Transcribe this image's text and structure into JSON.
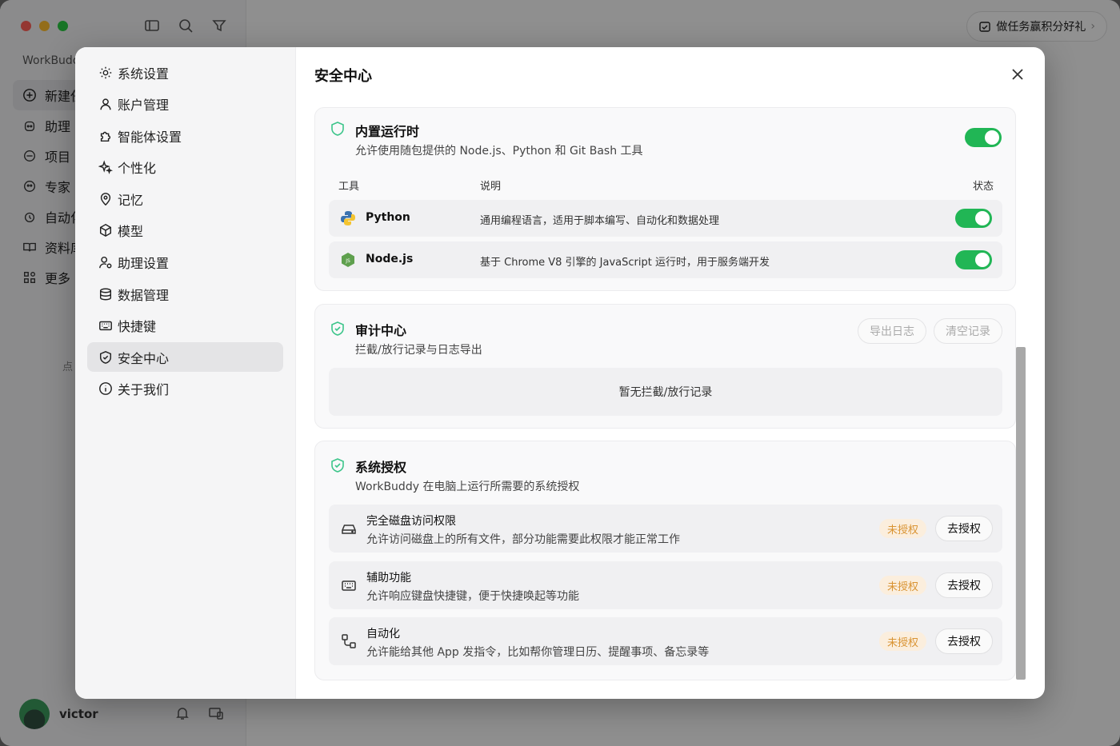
{
  "background": {
    "brand": "WorkBudd",
    "nav": [
      {
        "label": "新建任",
        "icon": "plus-circle-icon"
      },
      {
        "label": "助理",
        "icon": "robot-icon"
      },
      {
        "label": "项目",
        "icon": "project-icon"
      },
      {
        "label": "专家",
        "icon": "expert-icon"
      },
      {
        "label": "自动化",
        "icon": "alarm-icon"
      },
      {
        "label": "资料库",
        "icon": "book-icon"
      },
      {
        "label": "更多",
        "icon": "grid-icon"
      }
    ],
    "hint": "点",
    "user": {
      "name": "victor"
    },
    "promo": "做任务赢积分好礼"
  },
  "settings_nav": [
    {
      "label": "系统设置",
      "icon": "gear-icon"
    },
    {
      "label": "账户管理",
      "icon": "user-icon"
    },
    {
      "label": "智能体设置",
      "icon": "puzzle-icon"
    },
    {
      "label": "个性化",
      "icon": "sparkle-icon"
    },
    {
      "label": "记忆",
      "icon": "location-pin-icon"
    },
    {
      "label": "模型",
      "icon": "cube-icon"
    },
    {
      "label": "助理设置",
      "icon": "user-gear-icon"
    },
    {
      "label": "数据管理",
      "icon": "database-icon"
    },
    {
      "label": "快捷键",
      "icon": "keyboard-icon"
    },
    {
      "label": "安全中心",
      "icon": "shield-check-icon",
      "active": true
    },
    {
      "label": "关于我们",
      "icon": "info-icon"
    }
  ],
  "page_title": "安全中心",
  "runtime": {
    "title": "内置运行时",
    "subtitle": "允许使用随包提供的 Node.js、Python 和 Git Bash 工具",
    "enabled": true,
    "columns": {
      "tool": "工具",
      "desc": "说明",
      "status": "状态"
    },
    "tools": [
      {
        "name": "Python",
        "desc": "通用编程语言，适用于脚本编写、自动化和数据处理",
        "enabled": true
      },
      {
        "name": "Node.js",
        "desc": "基于 Chrome V8 引擎的 JavaScript 运行时，用于服务端开发",
        "enabled": true
      }
    ]
  },
  "audit": {
    "title": "审计中心",
    "subtitle": "拦截/放行记录与日志导出",
    "export_label": "导出日志",
    "clear_label": "清空记录",
    "empty_text": "暂无拦截/放行记录"
  },
  "auth": {
    "title": "系统授权",
    "subtitle": "WorkBuddy 在电脑上运行所需要的系统授权",
    "items": [
      {
        "name": "完全磁盘访问权限",
        "desc": "允许访问磁盘上的所有文件，部分功能需要此权限才能正常工作",
        "status": "未授权",
        "action": "去授权"
      },
      {
        "name": "辅助功能",
        "desc": "允许响应键盘快捷键，便于快捷唤起等功能",
        "status": "未授权",
        "action": "去授权"
      },
      {
        "name": "自动化",
        "desc": "允许能给其他 App 发指令，比如帮你管理日历、提醒事项、备忘录等",
        "status": "未授权",
        "action": "去授权"
      }
    ]
  },
  "colors": {
    "toggle_on": "#21b655",
    "shield": "#3cc58a",
    "badge_bg": "#fbeedd",
    "badge_text": "#d99332"
  }
}
